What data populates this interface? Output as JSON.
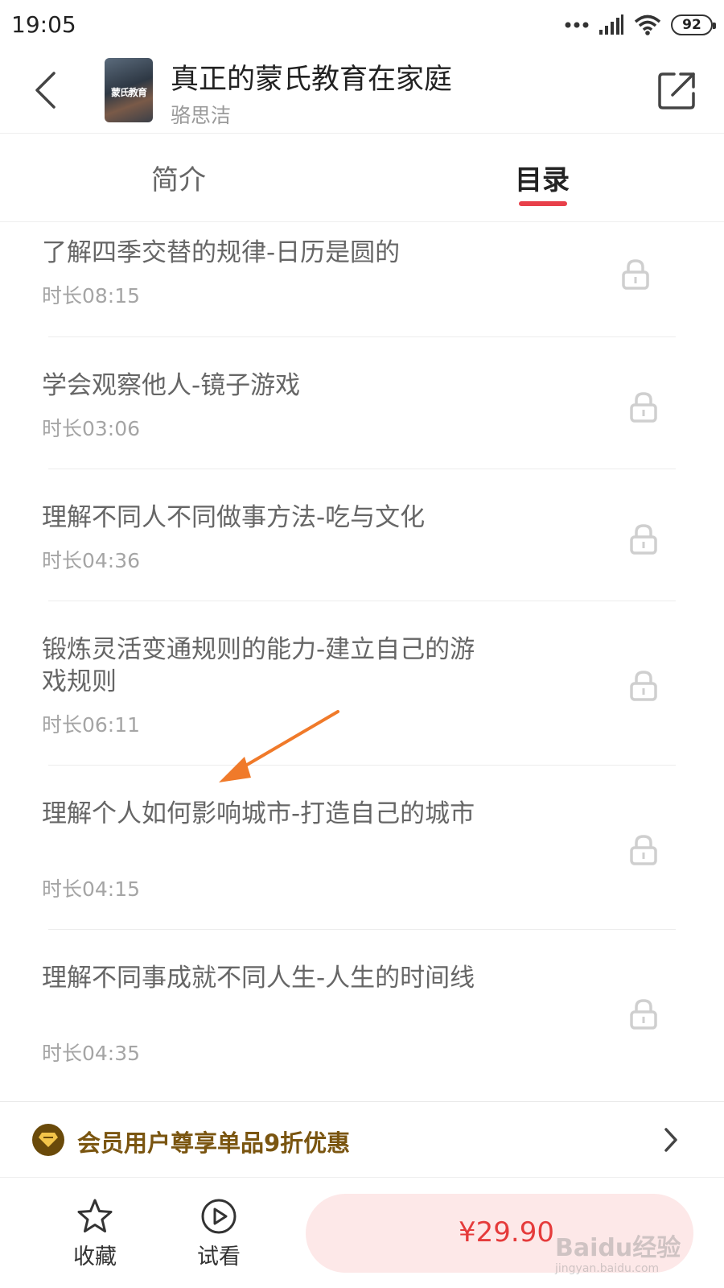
{
  "status_bar": {
    "time": "19:05",
    "battery": "92"
  },
  "header": {
    "cover_text": "蒙氏教育",
    "title": "真正的蒙氏教育在家庭",
    "author": "骆思洁"
  },
  "tabs": [
    {
      "label": "简介",
      "active": false
    },
    {
      "label": "目录",
      "active": true
    }
  ],
  "accent_color": "#e8404a",
  "lessons": [
    {
      "title": "了解四季交替的规律-日历是圆的",
      "duration": "时长08:15",
      "locked": true
    },
    {
      "title": "学会观察他人-镜子游戏",
      "duration": "时长03:06",
      "locked": true
    },
    {
      "title": "理解不同人不同做事方法-吃与文化",
      "duration": "时长04:36",
      "locked": true
    },
    {
      "title": "锻炼灵活变通规则的能力-建立自己的游戏规则",
      "duration": "时长06:11",
      "locked": true
    },
    {
      "title": "理解个人如何影响城市-打造自己的城市",
      "duration": "时长04:15",
      "locked": true
    },
    {
      "title": "理解不同事成就不同人生-人生的时间线",
      "duration": "时长04:35",
      "locked": true
    }
  ],
  "member_bar": {
    "text": "会员用户尊享单品9折优惠"
  },
  "bottom_bar": {
    "favorite_label": "收藏",
    "preview_label": "试看",
    "price": "¥29.90"
  },
  "watermark": {
    "main": "Baidu经验",
    "sub": "jingyan.baidu.com"
  }
}
